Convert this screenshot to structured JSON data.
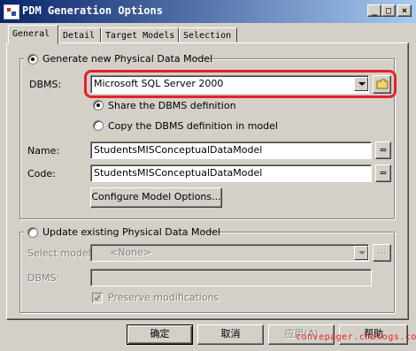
{
  "window": {
    "title": "PDM Generation Options",
    "controls": {
      "minimize": "_",
      "maximize": "□",
      "close": "×"
    }
  },
  "tabs": [
    {
      "label": "General",
      "active": true
    },
    {
      "label": "Detail",
      "active": false
    },
    {
      "label": "Target Models",
      "active": false
    },
    {
      "label": "Selection",
      "active": false
    }
  ],
  "generate": {
    "radio_label": "Generate new Physical Data Model",
    "selected": true,
    "dbms_label": "DBMS:",
    "dbms_value": "Microsoft SQL Server 2000",
    "share_label": "Share the DBMS definition",
    "share_selected": true,
    "copy_label": "Copy the DBMS definition in model",
    "copy_selected": false,
    "name_label": "Name:",
    "name_value": "StudentsMISConceptualDataModel",
    "code_label": "Code:",
    "code_value": "StudentsMISConceptualDataModel",
    "equals_label": "=",
    "configure_label": "Configure Model Options..."
  },
  "update": {
    "radio_label": "Update existing Physical Data Model",
    "selected": false,
    "select_model_label": "Select model:",
    "select_model_value": "<None>",
    "browse_label": "...",
    "dbms_label": "DBMS:",
    "dbms_value": "",
    "preserve_label": "Preserve modifications",
    "preserve_checked": true
  },
  "buttons": {
    "ok": "确定",
    "cancel": "取消",
    "apply": "应用(A)",
    "help": "帮助"
  },
  "watermark": "convepager.cnblogs.com",
  "colors": {
    "titlebar_start": "#0a246a",
    "titlebar_end": "#a6caf0",
    "dialog_face": "#d4d0c8",
    "highlight_red": "#e6202a"
  },
  "icons": {
    "title": "pdm-app-icon",
    "dbms_browse": "folder-icon"
  }
}
